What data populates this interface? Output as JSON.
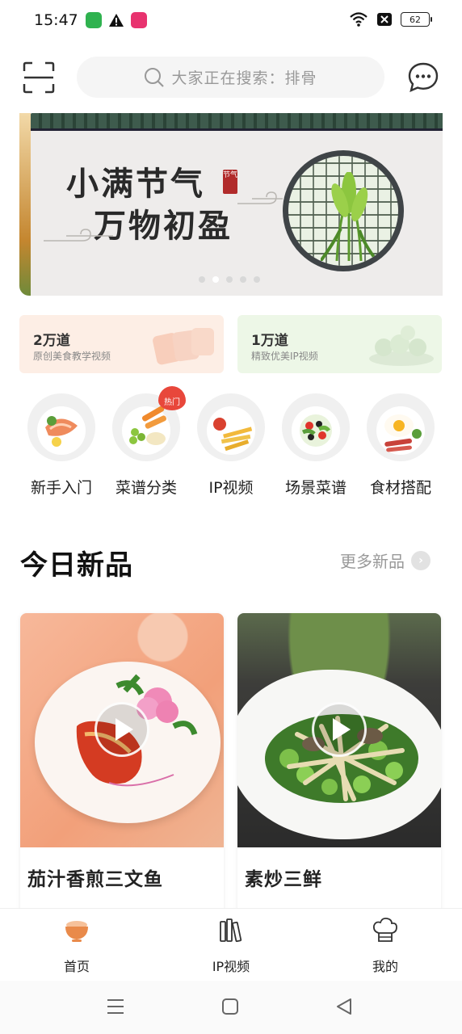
{
  "status_bar": {
    "time": "15:47",
    "battery": "62",
    "icons": [
      "sim-app-icon",
      "warning-icon",
      "app-notification-icon",
      "wifi-icon",
      "no-sim-icon",
      "battery-icon"
    ]
  },
  "header": {
    "scan_icon": "scan-icon",
    "search_placeholder": "大家正在搜索：排骨",
    "message_icon": "chat-bubble-icon"
  },
  "banner": {
    "title_line1": "小满节气",
    "title_line2": "万物初盈",
    "seal_text": "节气",
    "dot_count": 5,
    "active_dot": 1
  },
  "promos": [
    {
      "count": "2万道",
      "desc": "原创美食教学视频"
    },
    {
      "count": "1万道",
      "desc": "精致优美IP视频"
    }
  ],
  "categories": [
    {
      "label": "新手入门",
      "icon": "salmon-plate-icon"
    },
    {
      "label": "菜谱分类",
      "icon": "vegetable-platter-icon",
      "badge": "热门"
    },
    {
      "label": "IP视频",
      "icon": "fries-plate-icon"
    },
    {
      "label": "场景菜谱",
      "icon": "salad-bowl-icon"
    },
    {
      "label": "食材搭配",
      "icon": "fried-egg-icon"
    }
  ],
  "section": {
    "title": "今日新品",
    "more_label": "更多新品"
  },
  "products": [
    {
      "name": "茄汁香煎三文鱼"
    },
    {
      "name": "素炒三鲜"
    }
  ],
  "tabs": [
    {
      "label": "首页",
      "icon": "rice-bowl-icon",
      "active": true
    },
    {
      "label": "IP视频",
      "icon": "books-icon",
      "active": false
    },
    {
      "label": "我的",
      "icon": "chef-hat-icon",
      "active": false
    }
  ],
  "colors": {
    "accent": "#e8473b",
    "active_tab_icon": "#e98a4a",
    "promo_left_bg": "#fdeee5",
    "promo_right_bg": "#edf7e7"
  }
}
